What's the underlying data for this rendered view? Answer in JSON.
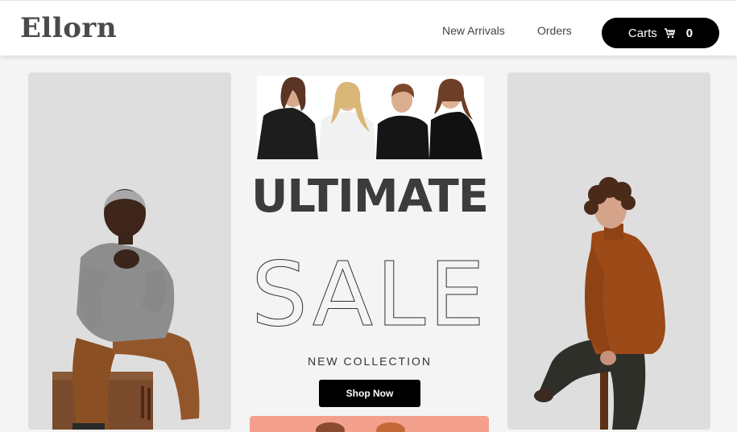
{
  "header": {
    "logo": "Ellorn",
    "nav": [
      {
        "label": "New Arrivals"
      },
      {
        "label": "Orders"
      }
    ],
    "cart": {
      "label": "Carts",
      "count": "0",
      "icon": "cart-icon"
    }
  },
  "hero": {
    "headline": "ULTIMATE",
    "outline_word": "SALE",
    "subheading": "NEW COLLECTION",
    "cta_label": "Shop Now"
  },
  "colors": {
    "accent": "#000000",
    "panel_bg": "#dedede",
    "promo": "#f3a08f"
  }
}
